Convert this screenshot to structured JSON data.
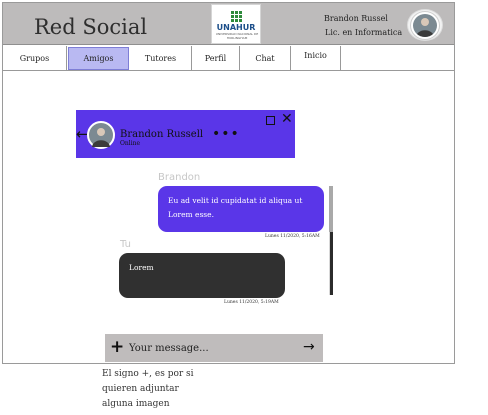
{
  "header": {
    "brand": "Red Social",
    "logo": {
      "name": "UNAHUR",
      "subtitle": "UNIVERSIDAD NACIONAL DE HURLINGHAM"
    },
    "user_name": "Brandon Russel",
    "user_role": "Lic. en Informatica"
  },
  "nav": {
    "items": [
      {
        "label": "Grupos",
        "active": false
      },
      {
        "label": "Amigos",
        "active": true
      },
      {
        "label": "Tutores",
        "active": false
      },
      {
        "label": "Perfil",
        "active": false
      },
      {
        "label": "Chat",
        "active": false
      },
      {
        "label": "Inicio",
        "active": false
      }
    ]
  },
  "chat": {
    "contact_name": "Brandon Russell",
    "contact_status": "Online",
    "back_icon": "←",
    "menu_icon": "•••",
    "close_icon": "✕",
    "accent_color": "#5a36e8",
    "messages": [
      {
        "sender": "Brandon",
        "text": "Eu ad velit id cupidatat id aliqua ut Lorem esse.",
        "timestamp": "Lunes 11/2020, 5:16AM",
        "side": "left"
      },
      {
        "sender": "Tu",
        "text": "Lorem",
        "timestamp": "Lunes 11/2020, 5:19AM",
        "side": "right"
      }
    ],
    "composer": {
      "plus_icon": "+",
      "placeholder": "Your message...",
      "send_icon": "→"
    }
  },
  "note": "El signo +, es por si quieren adjuntar alguna imagen"
}
